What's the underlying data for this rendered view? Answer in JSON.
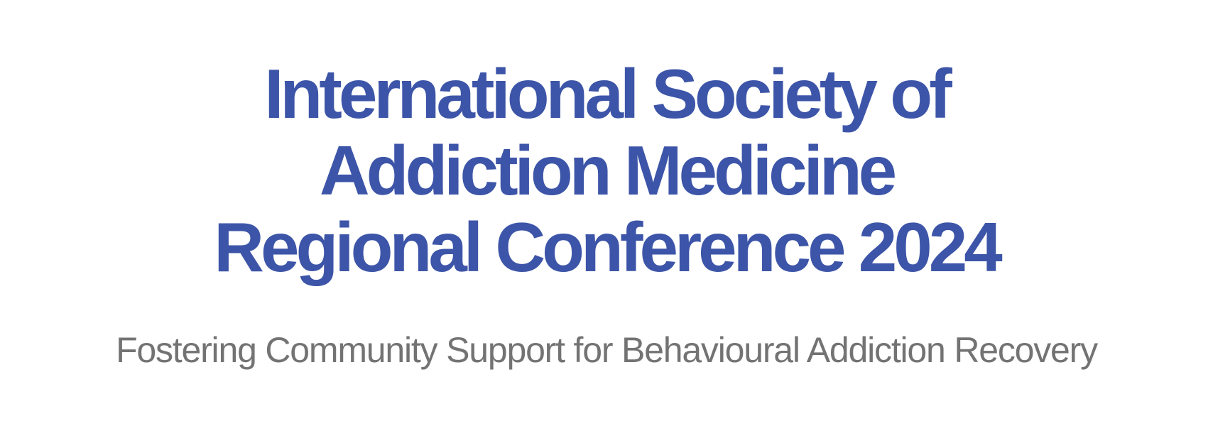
{
  "header": {
    "title_lines": [
      "International Society of",
      "Addiction Medicine",
      "Regional Conference 2024"
    ],
    "subtitle": "Fostering Community Support for Behavioural Addiction Recovery"
  },
  "colors": {
    "title": "#3d55a8",
    "subtitle": "#737373",
    "background": "#ffffff"
  }
}
